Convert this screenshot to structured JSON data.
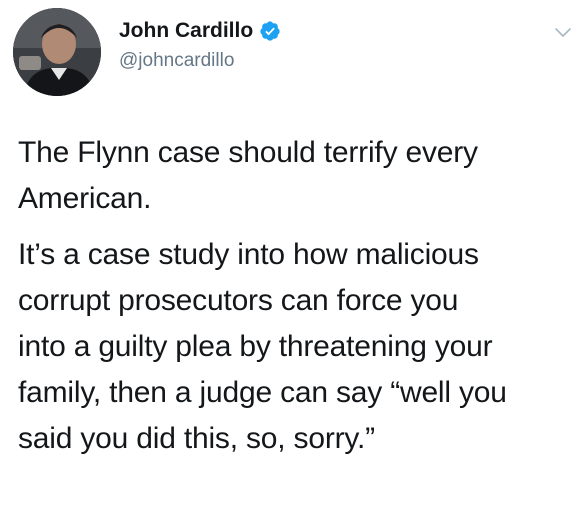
{
  "author": {
    "display_name": "John Cardillo",
    "handle": "@johncardillo",
    "verified": true,
    "avatar_icon": "profile-photo",
    "verified_icon": "verified-badge-icon",
    "verified_color": "#1da1f2"
  },
  "menu": {
    "icon": "chevron-down-icon",
    "color": "#aab8c2"
  },
  "tweet": {
    "paragraphs": [
      "The Flynn case should terrify every\nAmerican.",
      "It’s a case study into how malicious\ncorrupt prosecutors can force you\ninto a guilty plea by threatening your\nfamily, then a judge can say “well you\nsaid you did this, so, sorry.”"
    ]
  }
}
